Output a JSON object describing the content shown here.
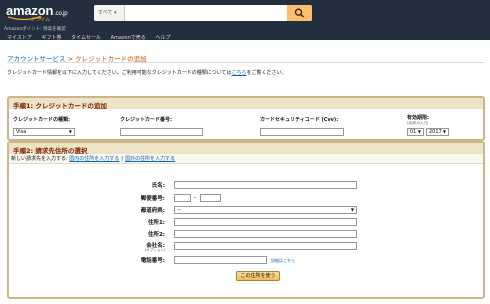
{
  "header": {
    "logo_text": "amazon",
    "logo_tld": ".co.jp",
    "logo_subtitle": "プライム",
    "search_category": "すべて",
    "search_value": "",
    "sub_text": "Amazonポイント: 残高を確認",
    "nav_items": [
      "マイストア",
      "ギフト券",
      "タイムセール",
      "Amazonで売る",
      "ヘルプ"
    ]
  },
  "breadcrumb": {
    "parent": "アカウントサービス",
    "separator": ">",
    "current": "クレジットカードの追加"
  },
  "intro": {
    "text_before": "クレジットカード情報を以下に入力してください。ご利用可能なクレジットカードの種類については",
    "link": "こちら",
    "text_after": "をご覧ください。"
  },
  "step1": {
    "title": "手順1: クレジットカードの追加",
    "card_type_label": "クレジットカードの種類:",
    "card_type_value": "Visa",
    "card_number_label": "クレジットカード番号:",
    "card_number_value": "",
    "cvv_label": "カードセキュリティコード (Cvv):",
    "cvv_value": "",
    "expiry_label": "有効期限:",
    "expiry_sublabel": "(月/年の入力)",
    "expiry_month": "01",
    "expiry_year": "2017"
  },
  "step2": {
    "title": "手順2: 請求先住所の選択",
    "new_address_prefix": "新しい請求先を入力する:",
    "domestic_link": "国内の住所を入力する",
    "separator": "|",
    "overseas_link": "国外の住所を入力する",
    "name_label": "氏名:",
    "postal_label": "郵便番号:",
    "postal_dash": "-",
    "prefecture_label": "都道府県:",
    "prefecture_value": "--",
    "address1_label": "住所1:",
    "address2_label": "住所2:",
    "company_label": "会社名:",
    "company_note": "(オプション)",
    "phone_label": "電話番号:",
    "details_link": "詳細はこちら",
    "submit_label": "この住所を使う"
  }
}
